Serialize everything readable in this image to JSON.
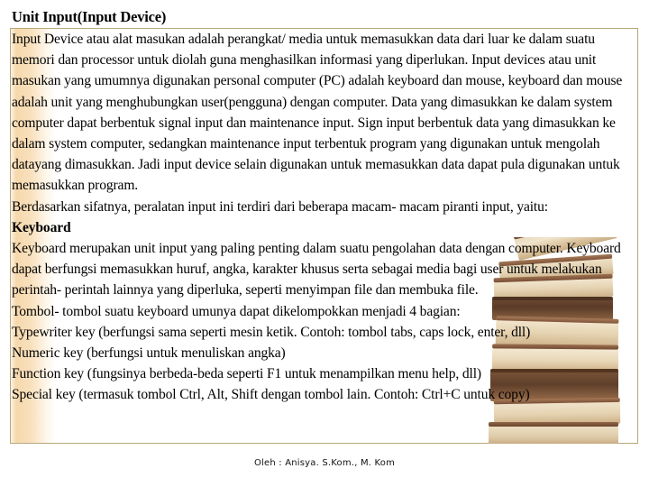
{
  "slide": {
    "title": "Unit Input(Input Device)",
    "footer": "Oleh : Anisya. S.Kom., M. Kom"
  },
  "colors": {
    "box_border": "#b6a87a",
    "accent_band": "#f6d6a8",
    "text": "#000000",
    "background": "#ffffff"
  },
  "body": {
    "paragraph_1": "Input Device  atau alat masukan adalah perangkat/ media untuk memasukkan data dari luar ke dalam suatu memori dan processor untuk diolah guna menghasilkan informasi yang diperlukan. Input devices atau unit masukan yang umumnya digunakan personal computer (PC) adalah keyboard dan mouse, keyboard dan mouse adalah unit yang menghubungkan user(pengguna) dengan computer. Data yang dimasukkan ke dalam system computer dapat berbentuk signal input dan maintenance input. Sign input berbentuk data yang dimasukkan ke dalam system computer, sedangkan maintenance input terbentuk program yang digunakan untuk mengolah datayang dimasukkan. Jadi input device selain digunakan untuk memasukkan data dapat pula digunakan untuk memasukkan program.",
    "paragraph_2": "Berdasarkan sifatnya, peralatan input ini terdiri dari beberapa macam- macam piranti input, yaitu:",
    "heading_keyboard": "Keyboard",
    "paragraph_3": "Keyboard merupakan unit input yang paling penting dalam suatu pengolahan data dengan computer. Keyboard dapat berfungsi memasukkan huruf, angka, karakter khusus serta sebagai media bagi user untuk melakukan perintah- perintah lainnya yang diperluka, seperti menyimpan file dan membuka file.",
    "paragraph_4": "Tombol- tombol suatu keyboard umunya dapat dikelompokkan menjadi 4 bagian:",
    "list_item_1": "Typewriter key (berfungsi sama seperti mesin ketik. Contoh: tombol tabs, caps lock, enter, dll)",
    "list_item_2": "Numeric key (berfungsi untuk menuliskan angka)",
    "list_item_3": "Function key (fungsinya berbeda-beda seperti F1 untuk menampilkan menu help, dll)",
    "list_item_4": "Special key (termasuk tombol Ctrl, Alt, Shift dengan tombol lain. Contoh: Ctrl+C untuk copy)"
  },
  "decoration": {
    "book_stack_alt": "book-stack-photo"
  }
}
